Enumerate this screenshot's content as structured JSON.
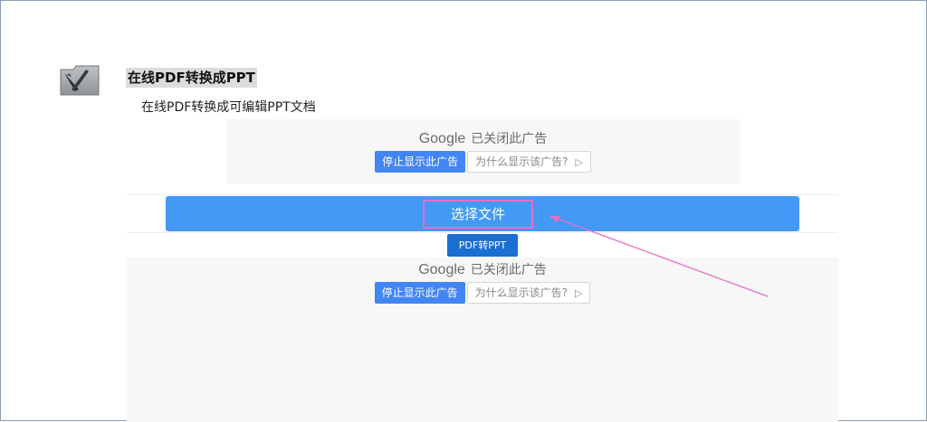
{
  "header": {
    "title": "在线PDF转换成PPT",
    "subtitle": "在线PDF转换成可编辑PPT文档"
  },
  "ads": [
    {
      "brand": "Google",
      "closed_text": "已关闭此广告",
      "stop_label": "停止显示此广告",
      "why_label": "为什么显示该广告?",
      "why_icon": "play-triangle-icon"
    },
    {
      "brand": "Google",
      "closed_text": "已关闭此广告",
      "stop_label": "停止显示此广告",
      "why_label": "为什么显示该广告?",
      "why_icon": "play-triangle-icon"
    }
  ],
  "upload": {
    "select_label": "选择文件",
    "convert_label": "PDF转PPT"
  },
  "colors": {
    "primary": "#4399f5",
    "convert": "#1a6fd1",
    "annotation": "#e46fc4",
    "ad_button": "#4285f4"
  },
  "icons": {
    "logo": "pdf-tool-folder-icon"
  }
}
